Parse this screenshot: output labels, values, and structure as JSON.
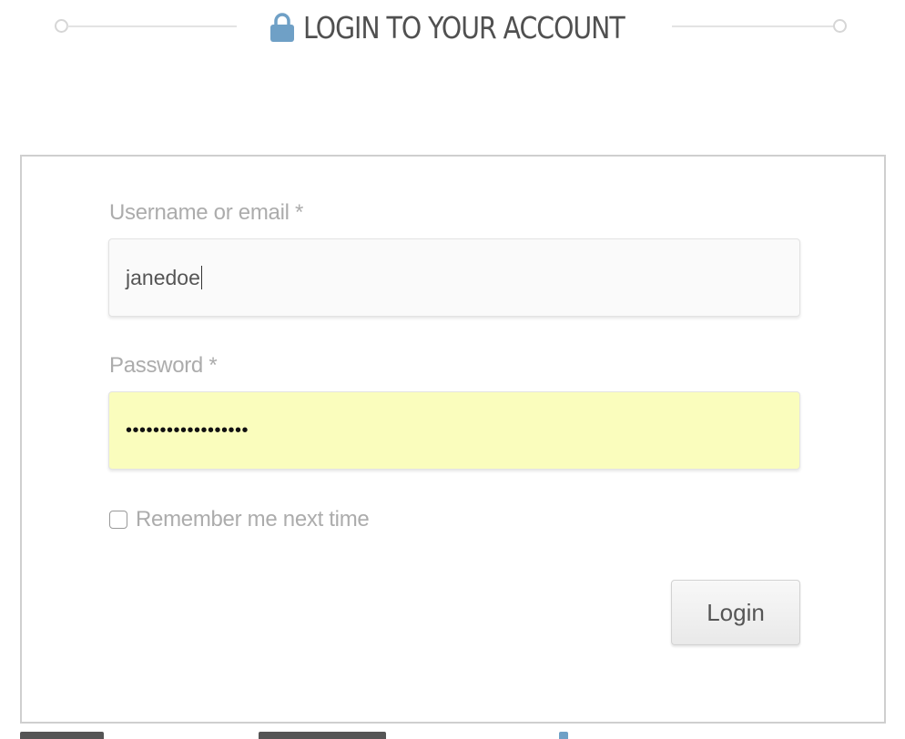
{
  "heading": {
    "title": "LOGIN TO YOUR ACCOUNT",
    "icon": "lock-icon",
    "icon_color": "#6fa0c6"
  },
  "form": {
    "username_label": "Username or email *",
    "username_value": "janedoe",
    "password_label": "Password *",
    "password_value": "••••••••••••••••••",
    "remember_label": "Remember me next time",
    "remember_checked": false,
    "login_label": "Login"
  },
  "colors": {
    "label_text": "#acacac",
    "password_autofill_bg": "#fafdbd",
    "border": "#cfcfcf"
  }
}
